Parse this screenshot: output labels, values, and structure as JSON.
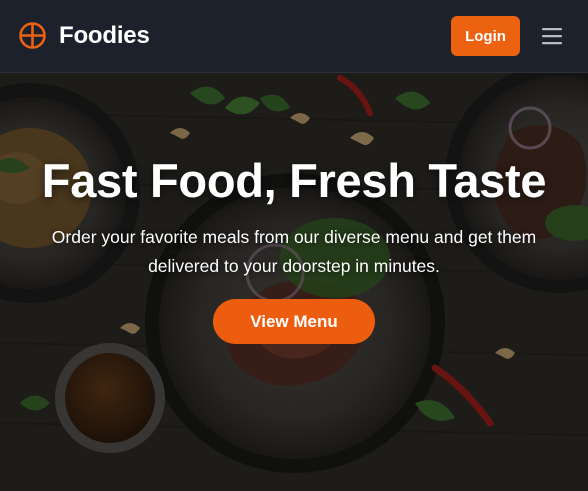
{
  "navbar": {
    "brand_icon": "circle-cross-logo-icon",
    "brand_name": "Foodies",
    "login_label": "Login",
    "menu_icon": "hamburger-menu-icon"
  },
  "hero": {
    "title": "Fast Food, Fresh Taste",
    "subtitle_line1": "Order your favorite meals from our diverse menu and get them",
    "subtitle_line2": "delivered to your doorstep in minutes.",
    "cta_label": "View Menu"
  },
  "colors": {
    "accent": "#ec6211",
    "navbar_bg": "#1d212b",
    "text_light": "#ffffff"
  }
}
